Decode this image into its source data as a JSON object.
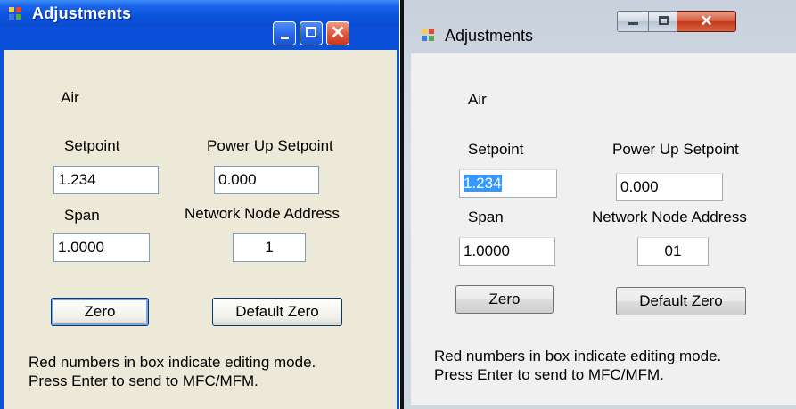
{
  "windows": [
    {
      "title": "Adjustments",
      "gas": "Air",
      "setpoint_label": "Setpoint",
      "setpoint_value": "1.234",
      "power_up_label": "Power Up Setpoint",
      "power_up_value": "0.000",
      "span_label": "Span",
      "span_value": "1.0000",
      "node_label": "Network Node Address",
      "node_value": "1",
      "zero_button": "Zero",
      "default_zero_button": "Default Zero",
      "message_line1": "Red numbers in box indicate editing mode.",
      "message_line2": "Press Enter to send to MFC/MFM."
    },
    {
      "title": "Adjustments",
      "gas": "Air",
      "setpoint_label": "Setpoint",
      "setpoint_value": "1.234",
      "power_up_label": "Power Up Setpoint",
      "power_up_value": "0.000",
      "span_label": "Span",
      "span_value": "1.0000",
      "node_label": "Network Node Address",
      "node_value": "01",
      "zero_button": "Zero",
      "default_zero_button": "Default Zero",
      "message_line1": "Red numbers in box indicate editing mode.",
      "message_line2": "Press Enter to send to MFC/MFM."
    }
  ],
  "icons": {
    "app": "app-grid-icon",
    "minimize": "minimize-icon",
    "maximize": "maximize-icon",
    "close": "close-icon"
  },
  "colors": {
    "xp_titlebar": "#0b52dc",
    "xp_client": "#ece9d8",
    "xp_close": "#e0553a",
    "vista_client": "#f0f0f0",
    "selection": "#3399ff"
  }
}
